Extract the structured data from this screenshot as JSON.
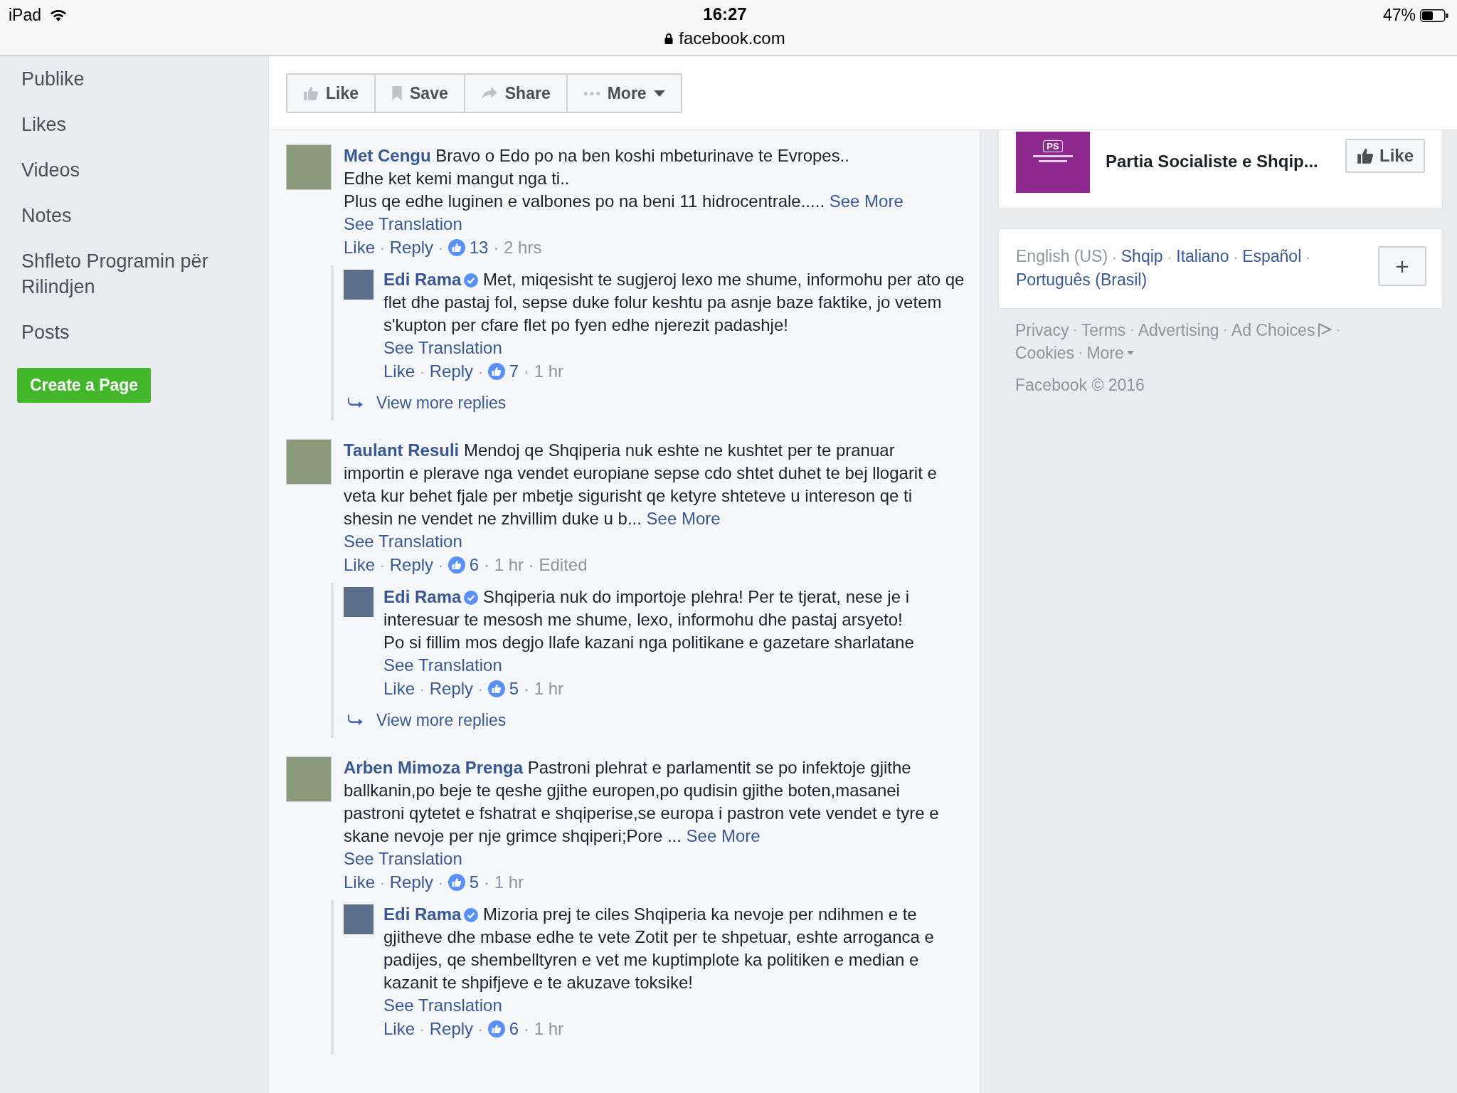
{
  "status_bar": {
    "device": "iPad",
    "time": "16:27",
    "url": "facebook.com",
    "battery": "47%"
  },
  "sidebar": {
    "items": [
      "Publike",
      "Likes",
      "Videos",
      "Notes",
      "Shfleto Programin për Rilindjen",
      "Posts"
    ],
    "create_button": "Create a Page"
  },
  "action_bar": [
    {
      "kind": "like",
      "label": "Like"
    },
    {
      "kind": "save",
      "label": "Save"
    },
    {
      "kind": "share",
      "label": "Share"
    },
    {
      "kind": "more",
      "label": "More"
    }
  ],
  "comments": [
    {
      "author": "Met Cengu",
      "verified": false,
      "text": "Bravo o Edo po na ben koshi mbeturinave te Evropes..\nEdhe ket kemi mangut nga ti..\nPlus qe edhe luginen e valbones po na beni 11 hidrocentrale.....",
      "see_more": "See More",
      "translation": "See Translation",
      "meta": [
        {
          "kind": "link",
          "text": "Like"
        },
        {
          "kind": "sep",
          "text": "·"
        },
        {
          "kind": "link",
          "text": "Reply"
        },
        {
          "kind": "sep",
          "text": "·"
        },
        {
          "kind": "reactions",
          "text": "13"
        },
        {
          "kind": "info",
          "text": "· 2 hrs"
        }
      ],
      "replies": [
        {
          "author": "Edi Rama",
          "verified": true,
          "text": "Met, miqesisht te sugjeroj lexo me shume, informohu per ato qe flet dhe pastaj fol, sepse duke folur keshtu pa asnje baze faktike, jo vetem s'kupton per cfare flet po fyen edhe njerezit padashje!",
          "translation": "See Translation",
          "meta": [
            {
              "kind": "link",
              "text": "Like"
            },
            {
              "kind": "sep",
              "text": "·"
            },
            {
              "kind": "link",
              "text": "Reply"
            },
            {
              "kind": "sep",
              "text": "·"
            },
            {
              "kind": "reactions",
              "text": "7"
            },
            {
              "kind": "info",
              "text": "· 1 hr"
            }
          ]
        }
      ],
      "view_more": "View more replies"
    },
    {
      "author": "Taulant Resuli",
      "verified": false,
      "text": "Mendoj qe Shqiperia nuk eshte ne kushtet per te pranuar importin e plerave nga vendet europiane sepse cdo shtet duhet te bej llogarit e veta kur behet fjale per mbetje sigurisht qe ketyre shteteve u intereson qe ti shesin ne vendet ne zhvillim duke u b...",
      "see_more": "See More",
      "translation": "See Translation",
      "meta": [
        {
          "kind": "link",
          "text": "Like"
        },
        {
          "kind": "sep",
          "text": "·"
        },
        {
          "kind": "link",
          "text": "Reply"
        },
        {
          "kind": "sep",
          "text": "·"
        },
        {
          "kind": "reactions",
          "text": "6"
        },
        {
          "kind": "info",
          "text": "· 1 hr · Edited"
        }
      ],
      "replies": [
        {
          "author": "Edi Rama",
          "verified": true,
          "text": "Shqiperia nuk do importoje plehra! Per te tjerat, nese je i interesuar te mesosh me shume, lexo, informohu dhe pastaj arsyeto!\nPo si fillim mos degjo llafe kazani nga politikane e gazetare sharlatane",
          "translation": "See Translation",
          "meta": [
            {
              "kind": "link",
              "text": "Like"
            },
            {
              "kind": "sep",
              "text": "·"
            },
            {
              "kind": "link",
              "text": "Reply"
            },
            {
              "kind": "sep",
              "text": "·"
            },
            {
              "kind": "reactions",
              "text": "5"
            },
            {
              "kind": "info",
              "text": "· 1 hr"
            }
          ]
        }
      ],
      "view_more": "View more replies"
    },
    {
      "author": "Arben Mimoza Prenga",
      "verified": false,
      "text": "Pastroni plehrat e parlamentit se po infektoje gjithe ballkanin,po beje te qeshe gjithe europen,po qudisin gjithe boten,masanei pastroni qytetet e fshatrat e shqiperise,se europa i pastron vete vendet e tyre e skane nevoje per nje grimce shqiperi;Pore ...",
      "see_more": "See More",
      "translation": "See Translation",
      "meta": [
        {
          "kind": "link",
          "text": "Like"
        },
        {
          "kind": "sep",
          "text": "·"
        },
        {
          "kind": "link",
          "text": "Reply"
        },
        {
          "kind": "sep",
          "text": "·"
        },
        {
          "kind": "reactions",
          "text": "5"
        },
        {
          "kind": "info",
          "text": "· 1 hr"
        }
      ],
      "replies": [
        {
          "author": "Edi Rama",
          "verified": true,
          "text": "Mizoria prej te ciles Shqiperia ka nevoje per ndihmen e te gjitheve dhe mbase edhe te vete Zotit per te shpetuar, eshte arroganca e padijes, qe shembelltyren e vet me kuptimplote ka politiken e median e kazanit te shpifjeve e te akuzave toksike!",
          "translation": "See Translation",
          "meta": [
            {
              "kind": "link",
              "text": "Like"
            },
            {
              "kind": "sep",
              "text": "·"
            },
            {
              "kind": "link",
              "text": "Reply"
            },
            {
              "kind": "sep",
              "text": "·"
            },
            {
              "kind": "reactions",
              "text": "6"
            },
            {
              "kind": "info",
              "text": "· 1 hr"
            }
          ]
        }
      ]
    }
  ],
  "page_card": {
    "logo_text": "PS",
    "name": "Partia Socialiste e Shqip...",
    "like_button": "Like"
  },
  "languages": {
    "items": [
      {
        "kind": "lang",
        "text": "English (US)",
        "selected": true
      },
      {
        "kind": "sep",
        "text": "·"
      },
      {
        "kind": "lang",
        "text": "Shqip",
        "selected": false
      },
      {
        "kind": "sep",
        "text": "·"
      },
      {
        "kind": "lang",
        "text": "Italiano",
        "selected": false
      },
      {
        "kind": "sep",
        "text": "·"
      },
      {
        "kind": "lang",
        "text": "Español",
        "selected": false
      },
      {
        "kind": "sep",
        "text": "·"
      },
      {
        "kind": "lang",
        "text": "Português (Brasil)",
        "selected": false
      }
    ],
    "add_button": "+"
  },
  "footer": {
    "links": [
      {
        "kind": "link",
        "text": "Privacy"
      },
      {
        "kind": "sep",
        "text": "·"
      },
      {
        "kind": "link",
        "text": "Terms"
      },
      {
        "kind": "sep",
        "text": "·"
      },
      {
        "kind": "link",
        "text": "Advertising"
      },
      {
        "kind": "sep",
        "text": "·"
      },
      {
        "kind": "adchoices",
        "text": "Ad Choices"
      },
      {
        "kind": "sep",
        "text": "·"
      },
      {
        "kind": "link",
        "text": "Cookies"
      },
      {
        "kind": "sep",
        "text": "·"
      },
      {
        "kind": "menu",
        "text": "More"
      }
    ],
    "copyright": "Facebook © 2016"
  }
}
